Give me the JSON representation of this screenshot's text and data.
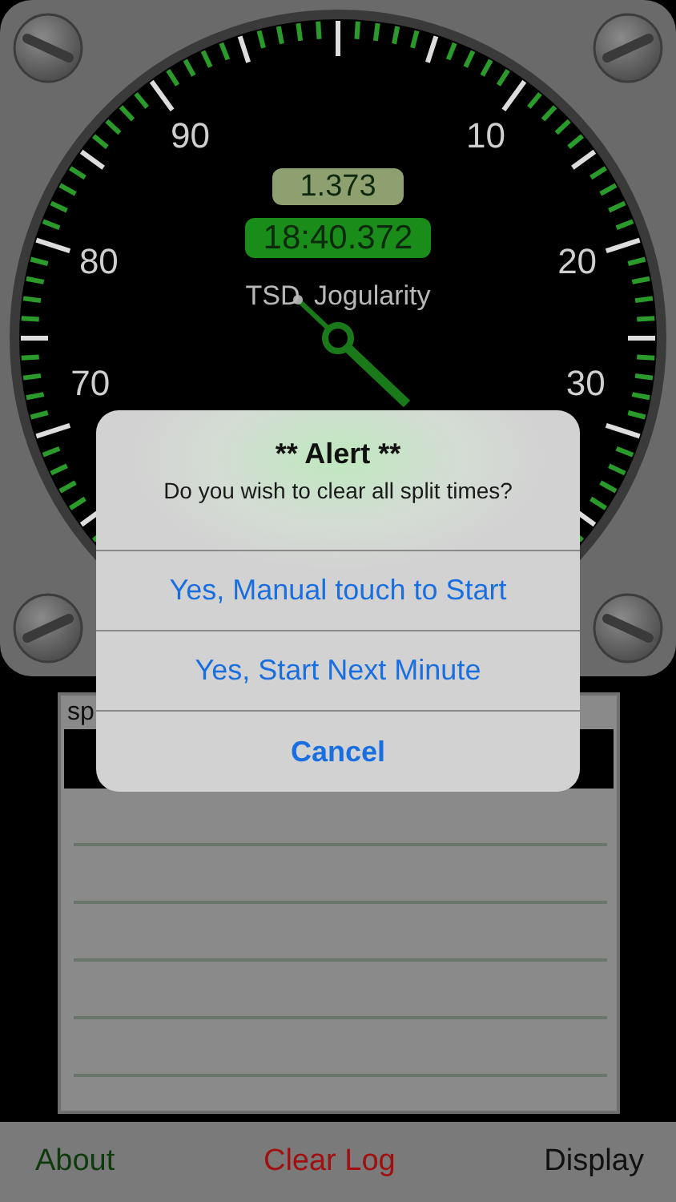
{
  "gauge": {
    "left_numerals": [
      "90",
      "80",
      "70"
    ],
    "right_numerals": [
      "10",
      "20",
      "30"
    ],
    "split": "1.373",
    "elapsed": "18:40.372",
    "brand": "TSD Jogularity"
  },
  "log": {
    "header": "sp"
  },
  "alert": {
    "title": "** Alert **",
    "message": "Do you wish to clear all split times?",
    "actions": [
      {
        "label": "Yes, Manual touch to Start",
        "kind": "default"
      },
      {
        "label": "Yes, Start Next Minute",
        "kind": "default"
      },
      {
        "label": "Cancel",
        "kind": "cancel"
      }
    ]
  },
  "toolbar": [
    {
      "label": "About",
      "color": "#0e3a0e"
    },
    {
      "label": "Clear Log",
      "color": "#a01010"
    },
    {
      "label": "Display",
      "color": "#111111"
    }
  ]
}
